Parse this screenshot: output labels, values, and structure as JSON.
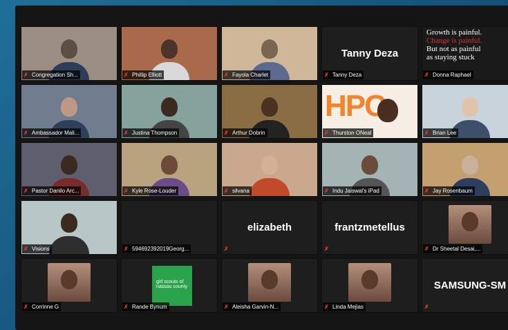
{
  "participants": [
    {
      "name": "Congregation Sh...",
      "type": "video"
    },
    {
      "name": "Phillip Elliott",
      "type": "video"
    },
    {
      "name": "Fayola Charlet",
      "type": "video"
    },
    {
      "name": "Tanny Deza",
      "type": "name",
      "display": "Tanny Deza"
    },
    {
      "name": "Donna Raphael",
      "type": "quote"
    },
    {
      "name": "Ambassador Mali...",
      "type": "video"
    },
    {
      "name": "Justina Thompson",
      "type": "video"
    },
    {
      "name": "Arthur Dobrin",
      "type": "video"
    },
    {
      "name": "Thurston ONeal",
      "type": "hpc"
    },
    {
      "name": "Brian Lee",
      "type": "video"
    },
    {
      "name": "Pastor Danilo Arc...",
      "type": "video"
    },
    {
      "name": "Kyle Rose-Louder",
      "type": "video"
    },
    {
      "name": "silvana",
      "type": "video"
    },
    {
      "name": "Indu Jaiswal's iPad",
      "type": "video"
    },
    {
      "name": "Jay Rosenbaum",
      "type": "video"
    },
    {
      "name": "Visions",
      "type": "video"
    },
    {
      "name": "594692392019Georg...",
      "type": "blank"
    },
    {
      "name": "",
      "type": "name",
      "display": "elizabeth"
    },
    {
      "name": "",
      "type": "name",
      "display": "frantzmetellus"
    },
    {
      "name": "Dr Sheetal Desai,...",
      "type": "avatar"
    },
    {
      "name": "Corrinne G",
      "type": "avatar"
    },
    {
      "name": "Rande Bynum",
      "type": "gs"
    },
    {
      "name": "Aleisha Garvin-N...",
      "type": "avatar"
    },
    {
      "name": "Linda Mejias",
      "type": "avatar"
    },
    {
      "name": "",
      "type": "name",
      "display": "SAMSUNG-SM"
    }
  ],
  "quote": {
    "line1": "Growth is painful.",
    "line2": "Change is painful.",
    "line3": "But not as painful",
    "line4": "as staying stuck"
  },
  "hpc_text": "HPC",
  "gs_text": "girl scouts of nassau county",
  "colors": {
    "mute": "#e33333",
    "hpc": "#f2842b",
    "gs": "#2aa34a"
  }
}
